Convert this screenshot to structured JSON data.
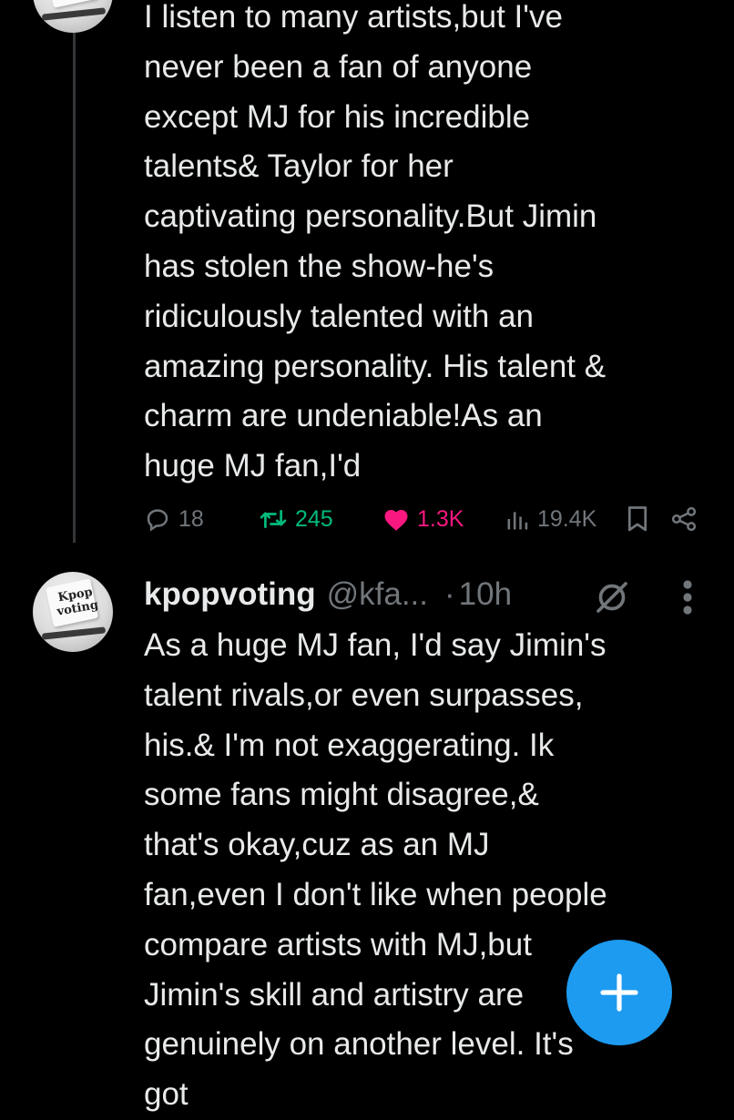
{
  "previous_tweet": {
    "lines": [
      "I listen to many artists,but I've",
      "never been a fan of anyone",
      "except MJ for his incredible",
      "talents& Taylor for her",
      "captivating personality.But Jimin",
      "has stolen the show-he's",
      "ridiculously talented with an",
      "amazing personality. His talent &",
      "charm are undeniable!As an",
      "huge MJ fan,I'd"
    ],
    "actions": {
      "replies": "18",
      "reposts": "245",
      "likes": "1.3K",
      "views": "19.4K"
    }
  },
  "reply_tweet": {
    "avatar_text": "Kpop voting",
    "display_name": "kpopvoting",
    "handle": "@kfa...",
    "separator": "·",
    "time": "10h",
    "lines": [
      "As a huge MJ fan, I'd say Jimin's",
      "talent rivals,or even surpasses,",
      "his.& I'm not exaggerating. Ik",
      "some fans might disagree,&",
      "that's okay,cuz as an MJ",
      "fan,even I don't like when people",
      "compare artists with MJ,but",
      "Jimin's skill and artistry are",
      "genuinely on another level. It's",
      "got"
    ]
  },
  "fab": {
    "label": "+"
  },
  "colors": {
    "background": "#000000",
    "text": "#e7e9ea",
    "muted": "#71767b",
    "repost": "#00ba7c",
    "like": "#f91880",
    "accent": "#1d9bf0"
  }
}
